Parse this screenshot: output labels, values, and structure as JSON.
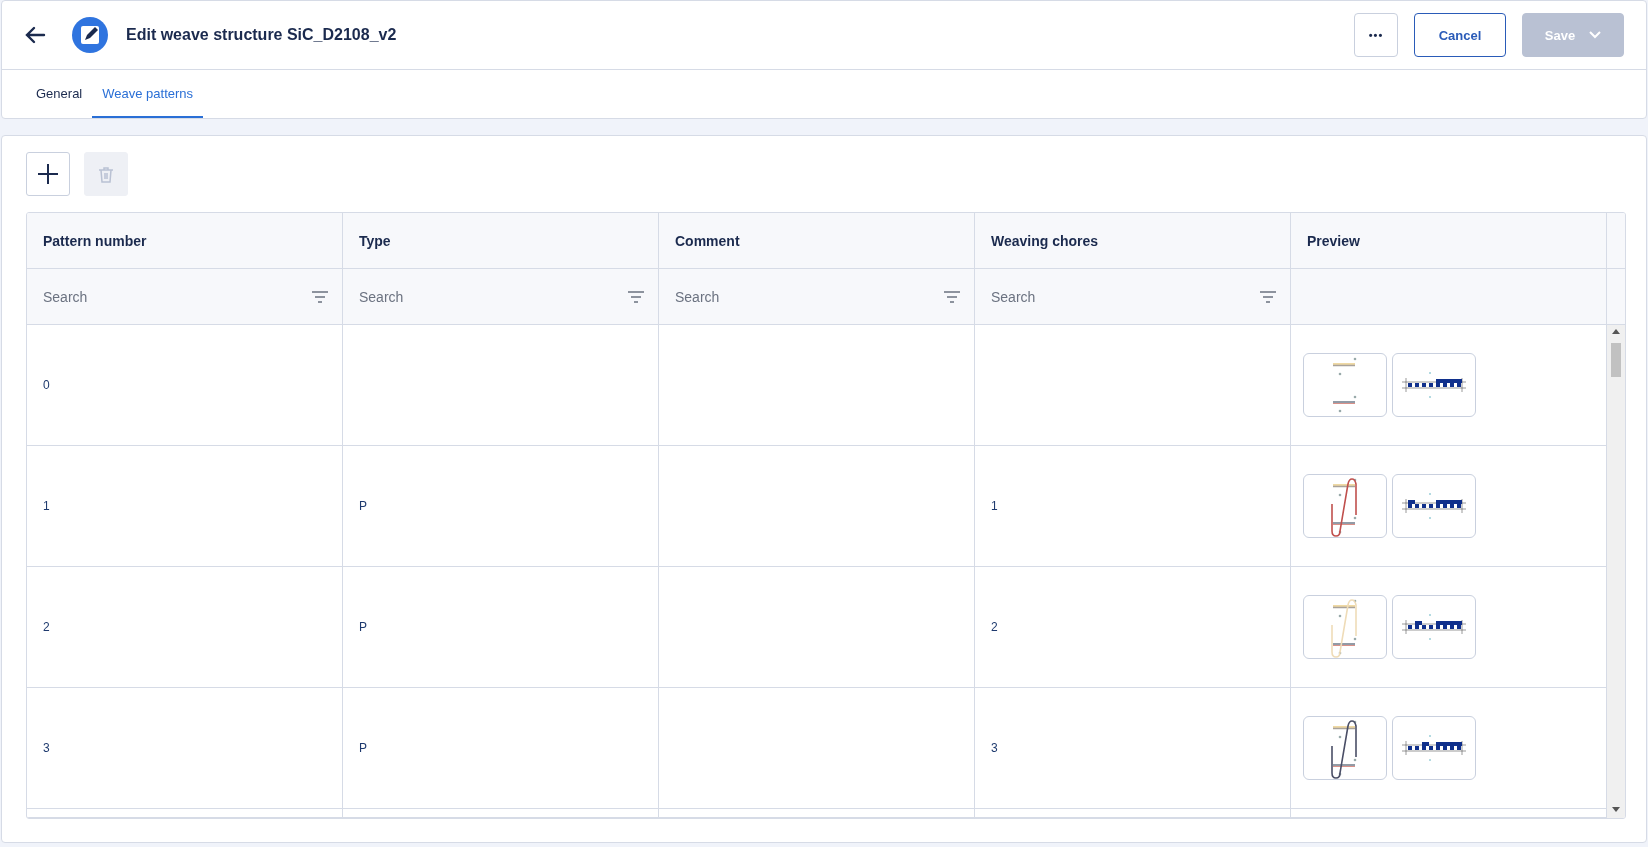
{
  "header": {
    "title": "Edit weave structure SiC_D2108_v2",
    "buttons": [
      {
        "kind": "more",
        "label": "•••"
      },
      {
        "kind": "outline",
        "label": "Cancel"
      },
      {
        "kind": "split",
        "label": "Save",
        "disabled": true
      }
    ]
  },
  "tabs": [
    {
      "label": "General",
      "selected": false
    },
    {
      "label": "Weave patterns",
      "selected": true
    }
  ],
  "toolbar": [
    {
      "kind": "add",
      "disabled": false
    },
    {
      "kind": "delete",
      "disabled": true
    }
  ],
  "table": {
    "columns": [
      {
        "label": "Pattern number",
        "placeholder": "Search"
      },
      {
        "label": "Type",
        "placeholder": "Search"
      },
      {
        "label": "Comment",
        "placeholder": "Search"
      },
      {
        "label": "Weaving chores",
        "placeholder": "Search"
      },
      {
        "label": "Preview"
      }
    ],
    "rows": [
      {
        "pattern_number": "0",
        "type": "",
        "comment": "",
        "weaving_chores": "",
        "preview": {
          "kind": "empty"
        }
      },
      {
        "pattern_number": "1",
        "type": "P",
        "comment": "",
        "weaving_chores": "1",
        "preview": {
          "kind": "loop",
          "color": "#c0504d"
        }
      },
      {
        "pattern_number": "2",
        "type": "P",
        "comment": "",
        "weaving_chores": "2",
        "preview": {
          "kind": "loop",
          "color": "#efdcb8"
        }
      },
      {
        "pattern_number": "3",
        "type": "P",
        "comment": "",
        "weaving_chores": "3",
        "preview": {
          "kind": "loop",
          "color": "#4a4e66"
        }
      }
    ]
  }
}
